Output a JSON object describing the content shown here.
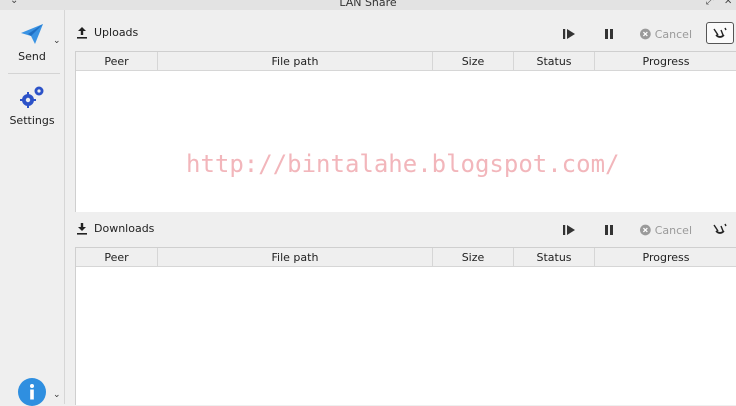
{
  "window": {
    "title": "LAN Share"
  },
  "sidebar": {
    "send_label": "Send",
    "settings_label": "Settings",
    "icons": {
      "send": "paper-plane-icon",
      "settings": "gears-icon",
      "info": "info-icon"
    }
  },
  "uploads": {
    "title": "Uploads",
    "cancel_label": "Cancel",
    "columns": [
      "Peer",
      "File path",
      "Size",
      "Status",
      "Progress"
    ]
  },
  "downloads": {
    "title": "Downloads",
    "cancel_label": "Cancel",
    "columns": [
      "Peer",
      "File path",
      "Size",
      "Status",
      "Progress"
    ]
  },
  "watermark": "http://bintalahe.blogspot.com/",
  "colors": {
    "accent": "#2f8fe0",
    "gear": "#2c52c8",
    "watermark": "#f2b6bb",
    "disabled": "#9a9a9a"
  }
}
